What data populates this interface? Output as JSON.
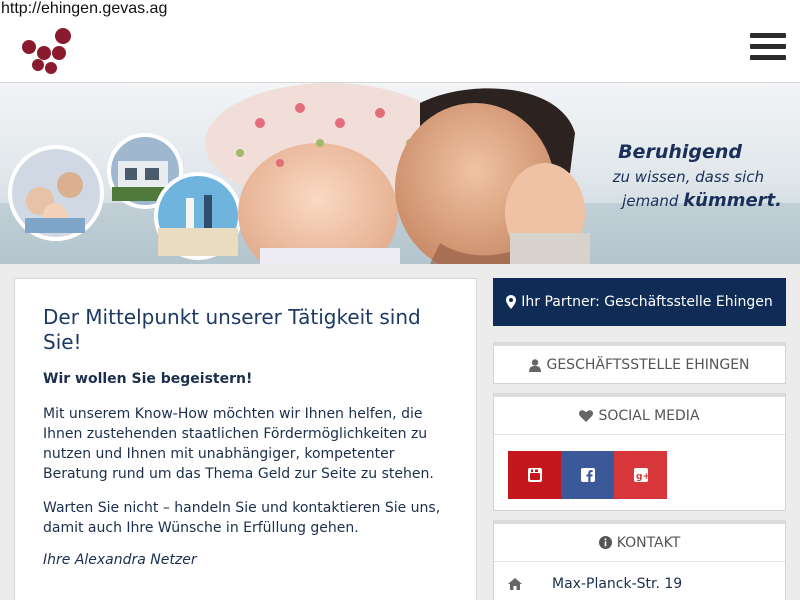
{
  "browser": {
    "url": "http://ehingen.gevas.ag"
  },
  "header": {
    "logo_icon": "grape-cluster-logo",
    "menu_icon": "hamburger-icon"
  },
  "banner": {
    "slogan_line1": "Beruhigend",
    "slogan_line2": "zu wissen, dass sich",
    "slogan_line3_prefix": "jemand ",
    "slogan_line3_bold": "kümmert."
  },
  "main": {
    "title": "Der Mittelpunkt unserer Tätigkeit sind Sie!",
    "subtitle": "Wir wollen Sie begeistern!",
    "paragraph1": "Mit unserem Know-How möchten wir Ihnen helfen, die Ihnen zustehenden staatlichen Fördermöglichkeiten zu nutzen und Ihnen mit unabhängiger, kompetenter Beratung rund um das Thema Geld zur Seite zu stehen.",
    "paragraph2": "Warten Sie nicht – handeln Sie und kontaktieren Sie uns, damit auch Ihre Wünsche in Erfüllung gehen.",
    "signature": "Ihre Alexandra Netzer"
  },
  "sidebar": {
    "partner_button": "Ihr Partner: Geschäftsstelle Ehingen",
    "office_heading": "GESCHÄFTSSTELLE EHINGEN",
    "social_heading": "SOCIAL MEDIA",
    "social": [
      {
        "icon": "youtube-icon",
        "color": "#c4171d"
      },
      {
        "icon": "facebook-icon",
        "color": "#3b5998"
      },
      {
        "icon": "google-plus-icon",
        "color": "#d7373b"
      }
    ],
    "contact_heading": "KONTAKT",
    "address_street": "Max-Planck-Str. 19"
  },
  "colors": {
    "brand_navy": "#0f2c56",
    "grape": "#8a1a2e"
  }
}
